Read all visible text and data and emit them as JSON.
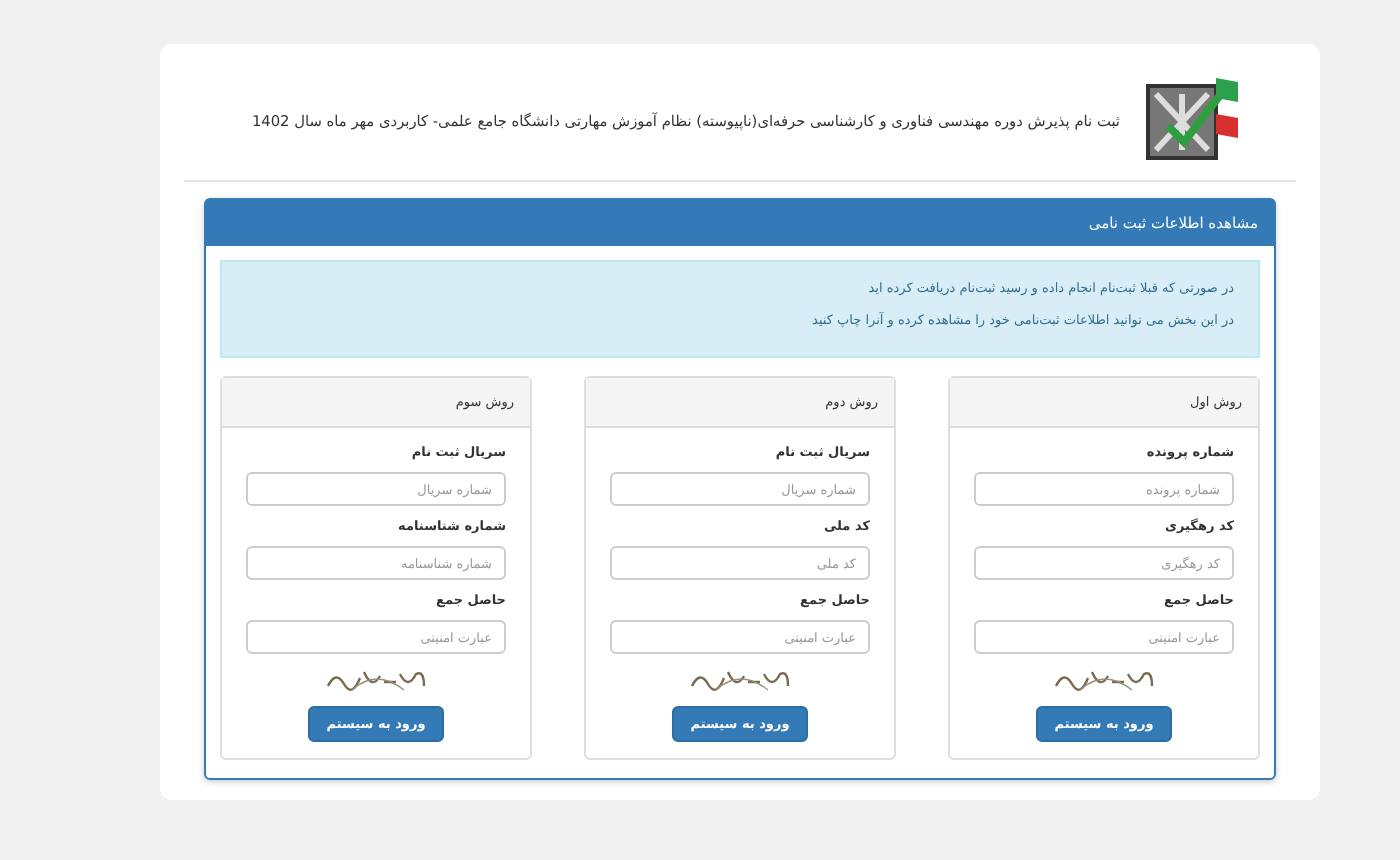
{
  "header": {
    "title": "ثبت نام پذیرش دوره مهندسی فناوری و کارشناسی حرفه‌ای(ناپیوسته) نظام آموزش مهارتی دانشگاه جامع علمی- کاربردی مهر ماه سال 1402"
  },
  "panel": {
    "title": "مشاهده اطلاعات ثبت نامی",
    "notes": [
      "در صورتی که قبلا ثبت‌نام انجام داده و رسید ثبت‌نام دریافت کرده اید",
      "در این بخش می توانید اطلاعات ثبت‌نامی خود را مشاهده کرده و آنرا چاپ کنید"
    ]
  },
  "methods": [
    {
      "title": "روش اول",
      "fields": [
        {
          "label": "شماره پرونده",
          "placeholder": "شماره پرونده"
        },
        {
          "label": "کد رهگیری",
          "placeholder": "کد رهگیری"
        },
        {
          "label": "حاصل جمع",
          "placeholder": "عبارت امنیتی"
        }
      ],
      "button": "ورود به سیستم"
    },
    {
      "title": "روش دوم",
      "fields": [
        {
          "label": "سریال ثبت نام",
          "placeholder": "شماره سریال"
        },
        {
          "label": "کد ملی",
          "placeholder": "کد ملی"
        },
        {
          "label": "حاصل جمع",
          "placeholder": "عبارت امنیتی"
        }
      ],
      "button": "ورود به سیستم"
    },
    {
      "title": "روش سوم",
      "fields": [
        {
          "label": "سریال ثبت نام",
          "placeholder": "شماره سریال"
        },
        {
          "label": "شماره شناسنامه",
          "placeholder": "شماره شناسنامه"
        },
        {
          "label": "حاصل جمع",
          "placeholder": "عبارت امنیتی"
        }
      ],
      "button": "ورود به سیستم"
    }
  ]
}
